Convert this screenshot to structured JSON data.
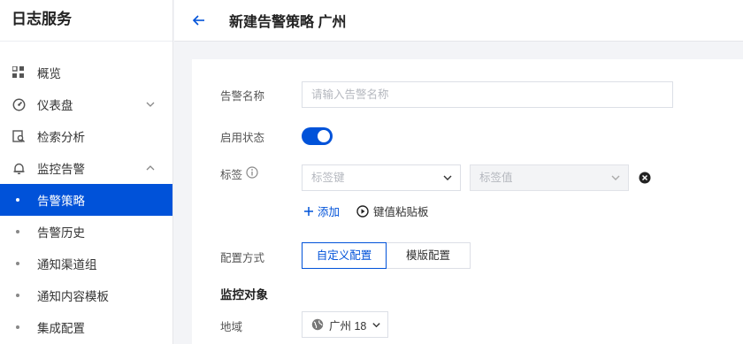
{
  "app": {
    "title": "日志服务"
  },
  "sidebar": {
    "items": [
      {
        "label": "概览"
      },
      {
        "label": "仪表盘"
      },
      {
        "label": "检索分析"
      },
      {
        "label": "监控告警"
      }
    ],
    "subitems": [
      {
        "label": "告警策略",
        "active": true
      },
      {
        "label": "告警历史"
      },
      {
        "label": "通知渠道组"
      },
      {
        "label": "通知内容模板"
      },
      {
        "label": "集成配置"
      }
    ]
  },
  "header": {
    "title": "新建告警策略 广州"
  },
  "form": {
    "name": {
      "label": "告警名称",
      "placeholder": "请输入告警名称"
    },
    "status": {
      "label": "启用状态",
      "enabled": true
    },
    "tags": {
      "label": "标签",
      "key_placeholder": "标签键",
      "value_placeholder": "标签值",
      "add_label": "添加",
      "clipboard_label": "键值粘贴板"
    },
    "config": {
      "label": "配置方式",
      "options": [
        "自定义配置",
        "模版配置"
      ],
      "selected": "自定义配置"
    },
    "monitor": {
      "section_title": "监控对象",
      "region_label": "地域",
      "region_value": "广州 18"
    }
  },
  "colors": {
    "primary": "#0052d9"
  }
}
